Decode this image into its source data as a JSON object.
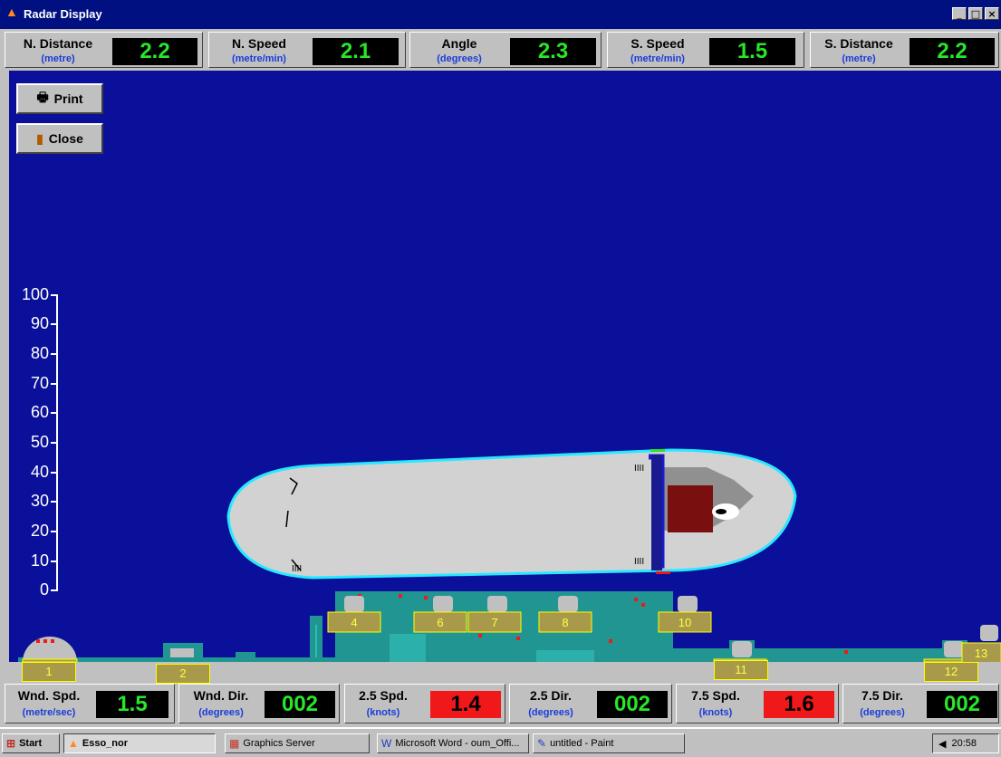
{
  "window": {
    "title": "Radar Display",
    "icon": "ship-icon"
  },
  "top_metrics": [
    {
      "label": "N. Distance",
      "unit": "(metre)",
      "value": "2.2"
    },
    {
      "label": "N. Speed",
      "unit": "(metre/min)",
      "value": "2.1"
    },
    {
      "label": "Angle",
      "unit": "(degrees)",
      "value": "2.3"
    },
    {
      "label": "S. Speed",
      "unit": "(metre/min)",
      "value": "1.5"
    },
    {
      "label": "S. Distance",
      "unit": "(metre)",
      "value": "2.2"
    }
  ],
  "buttons": {
    "print": "Print",
    "close": "Close"
  },
  "axis": {
    "ticks": [
      "100",
      "90",
      "80",
      "70",
      "60",
      "50",
      "40",
      "30",
      "20",
      "10",
      "0"
    ]
  },
  "berths": [
    "1",
    "2",
    "4",
    "6",
    "7",
    "8",
    "10",
    "11",
    "12",
    "13"
  ],
  "bottom_metrics": [
    {
      "label": "Wnd. Spd.",
      "unit": "(metre/sec)",
      "value": "1.5",
      "alert": false
    },
    {
      "label": "Wnd. Dir.",
      "unit": "(degrees)",
      "value": "002",
      "alert": false
    },
    {
      "label": "2.5 Spd.",
      "unit": "(knots)",
      "value": "1.4",
      "alert": true
    },
    {
      "label": "2.5 Dir.",
      "unit": "(degrees)",
      "value": "002",
      "alert": false
    },
    {
      "label": "7.5 Spd.",
      "unit": "(knots)",
      "value": "1.6",
      "alert": true
    },
    {
      "label": "7.5 Dir.",
      "unit": "(degrees)",
      "value": "002",
      "alert": false
    }
  ],
  "taskbar": {
    "start": "Start",
    "items": [
      "Esso_nor",
      "Graphics Server",
      "Microsoft Word - oum_Offi...",
      "untitled - Paint"
    ],
    "clock": "20:58"
  },
  "colors": {
    "background": "#0a109a",
    "hull": "#d2d2d2",
    "hull_outline": "#28e8ff",
    "pier": "#219591",
    "berth_label": "#a89a4a",
    "readout_green": "#28e628",
    "readout_alert": "#f01818"
  }
}
